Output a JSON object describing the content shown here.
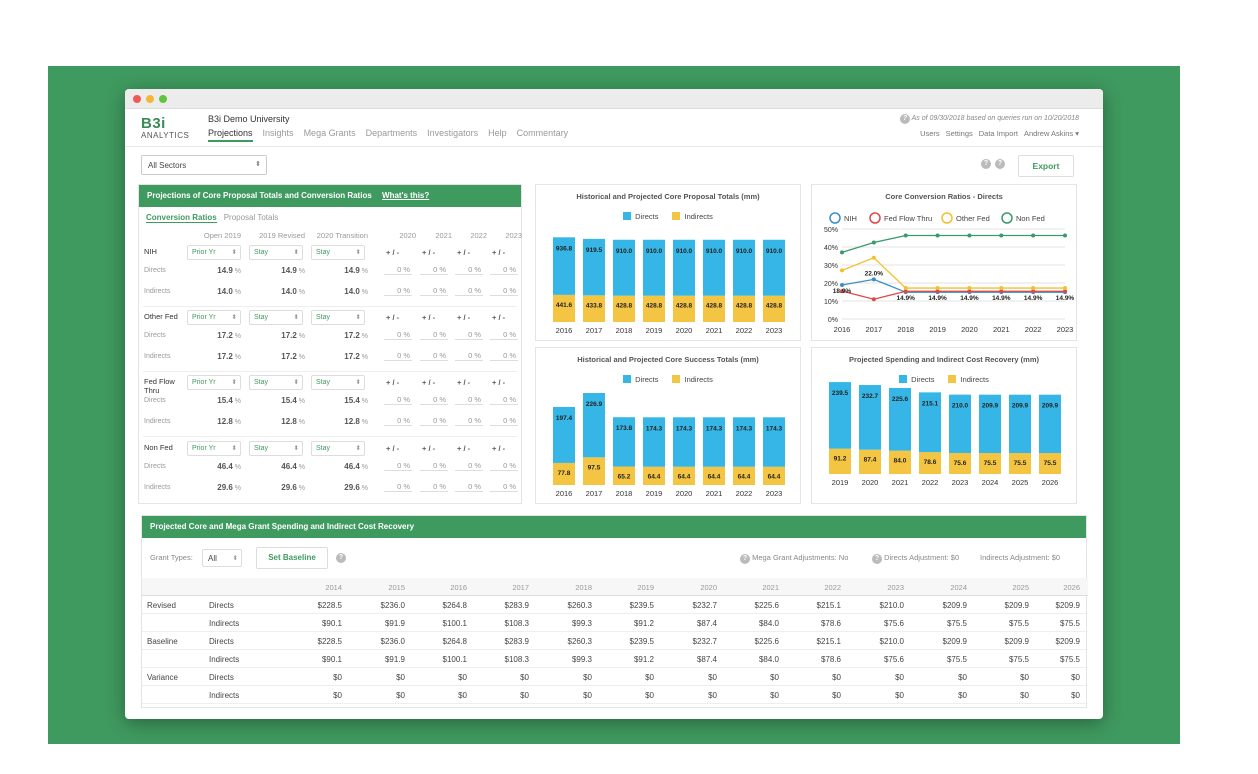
{
  "header": {
    "logo_text": "B3i",
    "logo_sub": "ANALYTICS",
    "university": "B3i Demo University",
    "nav": [
      "Projections",
      "Insights",
      "Mega Grants",
      "Departments",
      "Investigators",
      "Help",
      "Commentary"
    ],
    "as_of": "As of 09/30/2018 based on queries run on 10/20/2018",
    "user_nav": [
      "Users",
      "Settings",
      "Data Import",
      "Andrew Askins ▾"
    ]
  },
  "toolbar": {
    "sector": "All Sectors",
    "export": "Export"
  },
  "conversion": {
    "title": "Projections of Core Proposal Totals and Conversion Ratios",
    "whats_this": "What's this?",
    "tabs": [
      "Conversion Ratios",
      "Proposal Totals"
    ],
    "columns": [
      "Open 2019",
      "2019 Revised",
      "2020 Transition",
      "2020",
      "2021",
      "2022",
      "2023"
    ],
    "groups": [
      {
        "name": "NIH",
        "s1": "Prior Yr",
        "s2": "Stay",
        "s3": "Stay",
        "rows": [
          {
            "label": "Directs",
            "v": [
              "14.9",
              "14.9",
              "14.9"
            ]
          },
          {
            "label": "Indirects",
            "v": [
              "14.0",
              "14.0",
              "14.0"
            ]
          }
        ]
      },
      {
        "name": "Other Fed",
        "s1": "Prior Yr",
        "s2": "Stay",
        "s3": "Stay",
        "rows": [
          {
            "label": "Directs",
            "v": [
              "17.2",
              "17.2",
              "17.2"
            ]
          },
          {
            "label": "Indirects",
            "v": [
              "17.2",
              "17.2",
              "17.2"
            ]
          }
        ]
      },
      {
        "name": "Fed Flow Thru",
        "s1": "Prior Yr",
        "s2": "Stay",
        "s3": "Stay",
        "rows": [
          {
            "label": "Directs",
            "v": [
              "15.4",
              "15.4",
              "15.4"
            ]
          },
          {
            "label": "Indirects",
            "v": [
              "12.8",
              "12.8",
              "12.8"
            ]
          }
        ]
      },
      {
        "name": "Non Fed",
        "s1": "Prior Yr",
        "s2": "Stay",
        "s3": "Stay",
        "rows": [
          {
            "label": "Directs",
            "v": [
              "46.4",
              "46.4",
              "46.4"
            ]
          },
          {
            "label": "Indirects",
            "v": [
              "29.6",
              "29.6",
              "29.6"
            ]
          }
        ]
      }
    ],
    "pm": "+ / -",
    "zero": "0",
    "pct": "%"
  },
  "bottom": {
    "title": "Projected Core and Mega Grant Spending and Indirect Cost Recovery",
    "grant_types_label": "Grant Types:",
    "grant_types_value": "All",
    "set_baseline": "Set Baseline",
    "mega_adj": "Mega Grant Adjustments: No",
    "directs_adj": "Directs Adjustment: $0",
    "indirects_adj": "Indirects Adjustment: $0",
    "years": [
      "2014",
      "2015",
      "2016",
      "2017",
      "2018",
      "2019",
      "2020",
      "2021",
      "2022",
      "2023",
      "2024",
      "2025",
      "2026"
    ],
    "rows": [
      {
        "group": "Revised",
        "type": "Directs",
        "values": [
          "$228.5",
          "$236.0",
          "$264.8",
          "$283.9",
          "$260.3",
          "$239.5",
          "$232.7",
          "$225.6",
          "$215.1",
          "$210.0",
          "$209.9",
          "$209.9",
          "$209.9"
        ]
      },
      {
        "group": "",
        "type": "Indirects",
        "values": [
          "$90.1",
          "$91.9",
          "$100.1",
          "$108.3",
          "$99.3",
          "$91.2",
          "$87.4",
          "$84.0",
          "$78.6",
          "$75.6",
          "$75.5",
          "$75.5",
          "$75.5"
        ]
      },
      {
        "group": "Baseline",
        "type": "Directs",
        "values": [
          "$228.5",
          "$236.0",
          "$264.8",
          "$283.9",
          "$260.3",
          "$239.5",
          "$232.7",
          "$225.6",
          "$215.1",
          "$210.0",
          "$209.9",
          "$209.9",
          "$209.9"
        ]
      },
      {
        "group": "",
        "type": "Indirects",
        "values": [
          "$90.1",
          "$91.9",
          "$100.1",
          "$108.3",
          "$99.3",
          "$91.2",
          "$87.4",
          "$84.0",
          "$78.6",
          "$75.6",
          "$75.5",
          "$75.5",
          "$75.5"
        ]
      },
      {
        "group": "Variance",
        "type": "Directs",
        "values": [
          "$0",
          "$0",
          "$0",
          "$0",
          "$0",
          "$0",
          "$0",
          "$0",
          "$0",
          "$0",
          "$0",
          "$0",
          "$0"
        ]
      },
      {
        "group": "",
        "type": "Indirects",
        "values": [
          "$0",
          "$0",
          "$0",
          "$0",
          "$0",
          "$0",
          "$0",
          "$0",
          "$0",
          "$0",
          "$0",
          "$0",
          "$0"
        ]
      }
    ]
  },
  "colors": {
    "directs": "#35b6e6",
    "indirects": "#f4c542",
    "nih": "#3a8fc8",
    "fedflow": "#e04848",
    "otherfed": "#f2c031",
    "nonfed": "#3a9a6a",
    "accent": "#3f9a5f"
  },
  "chart_data": [
    {
      "type": "bar",
      "title": "Historical and Projected Core Proposal Totals (mm)",
      "categories": [
        "2016",
        "2017",
        "2018",
        "2019",
        "2020",
        "2021",
        "2022",
        "2023"
      ],
      "series": [
        {
          "name": "Directs",
          "values": [
            936.8,
            919.5,
            910.0,
            910.0,
            910.0,
            910.0,
            910.0,
            910.0
          ]
        },
        {
          "name": "Indirects",
          "values": [
            441.6,
            433.8,
            428.8,
            428.8,
            428.8,
            428.8,
            428.8,
            428.8
          ]
        }
      ],
      "stacked": true
    },
    {
      "type": "line",
      "title": "Core Conversion Ratios - Directs",
      "x": [
        "2016",
        "2017",
        "2018",
        "2019",
        "2020",
        "2021",
        "2022",
        "2023"
      ],
      "series": [
        {
          "name": "NIH",
          "values": [
            18.9,
            22.0,
            14.9,
            14.9,
            14.9,
            14.9,
            14.9,
            14.9
          ]
        },
        {
          "name": "Fed Flow Thru",
          "values": [
            15.5,
            11.0,
            15.4,
            15.4,
            15.4,
            15.4,
            15.4,
            15.4
          ]
        },
        {
          "name": "Other Fed",
          "values": [
            27.0,
            34.0,
            17.2,
            17.2,
            17.2,
            17.2,
            17.2,
            17.2
          ]
        },
        {
          "name": "Non Fed",
          "values": [
            37.0,
            42.5,
            46.4,
            46.4,
            46.4,
            46.4,
            46.4,
            46.4
          ]
        }
      ],
      "yticks": [
        "0%",
        "10%",
        "20%",
        "30%",
        "40%",
        "50%"
      ],
      "ylim": [
        0,
        50
      ],
      "labels": [
        "18.9%",
        "22.0%",
        "14.9%",
        "14.9%",
        "14.9%",
        "14.9%",
        "14.9%",
        "14.9%"
      ]
    },
    {
      "type": "bar",
      "title": "Historical and Projected Core Success Totals (mm)",
      "categories": [
        "2016",
        "2017",
        "2018",
        "2019",
        "2020",
        "2021",
        "2022",
        "2023"
      ],
      "series": [
        {
          "name": "Directs",
          "values": [
            197.4,
            226.9,
            173.8,
            174.3,
            174.3,
            174.3,
            174.3,
            174.3
          ]
        },
        {
          "name": "Indirects",
          "values": [
            77.8,
            97.5,
            65.2,
            64.4,
            64.4,
            64.4,
            64.4,
            64.4
          ]
        }
      ],
      "stacked": true
    },
    {
      "type": "bar",
      "title": "Projected Spending and Indirect Cost Recovery (mm)",
      "categories": [
        "2019",
        "2020",
        "2021",
        "2022",
        "2023",
        "2024",
        "2025",
        "2026"
      ],
      "series": [
        {
          "name": "Directs",
          "values": [
            239.5,
            232.7,
            225.6,
            215.1,
            210.0,
            209.9,
            209.9,
            209.9
          ]
        },
        {
          "name": "Indirects",
          "values": [
            91.2,
            87.4,
            84.0,
            78.6,
            75.6,
            75.5,
            75.5,
            75.5
          ]
        }
      ],
      "stacked": true
    }
  ]
}
